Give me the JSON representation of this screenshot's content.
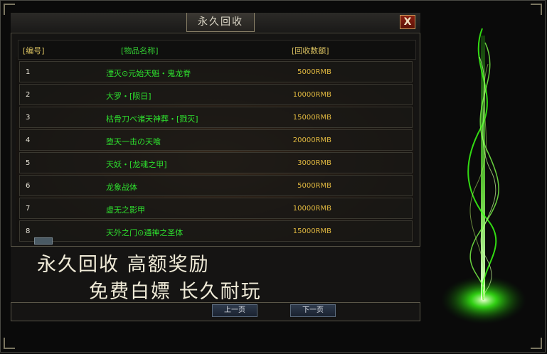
{
  "window": {
    "title": "永久回收",
    "close_label": "X"
  },
  "table": {
    "headers": [
      "[编号]",
      "[物品名称]",
      "[回收数额]"
    ],
    "rows": [
      {
        "num": "1",
        "name": "湮灭⊙元始天魁・鬼龙脊",
        "amount": "5000RMB"
      },
      {
        "num": "2",
        "name": "大罗・[陨日]",
        "amount": "10000RMB"
      },
      {
        "num": "3",
        "name": "枯骨刀ベ诸天神葬・[戮灭]",
        "amount": "15000RMB"
      },
      {
        "num": "4",
        "name": "堕天一击の天喰",
        "amount": "20000RMB"
      },
      {
        "num": "5",
        "name": "天妖・[龙魂之甲]",
        "amount": "3000RMB"
      },
      {
        "num": "6",
        "name": "龙象战体",
        "amount": "5000RMB"
      },
      {
        "num": "7",
        "name": "虚无之影甲",
        "amount": "10000RMB"
      },
      {
        "num": "8",
        "name": "天外之门⊙通神之圣体",
        "amount": "15000RMB"
      }
    ]
  },
  "banner": {
    "line1": "永久回收 高额奖励",
    "line2": "免费白嫖 长久耐玩"
  },
  "pagination": {
    "prev_label": "上一页",
    "next_label": "下一页"
  },
  "colors": {
    "item_name": "#2ee02e",
    "amount": "#e0b840",
    "header": "#d8c060",
    "effect_glow": "#39ff14"
  },
  "icons": {
    "close": "close-icon",
    "effect": "green-light-pillar"
  }
}
